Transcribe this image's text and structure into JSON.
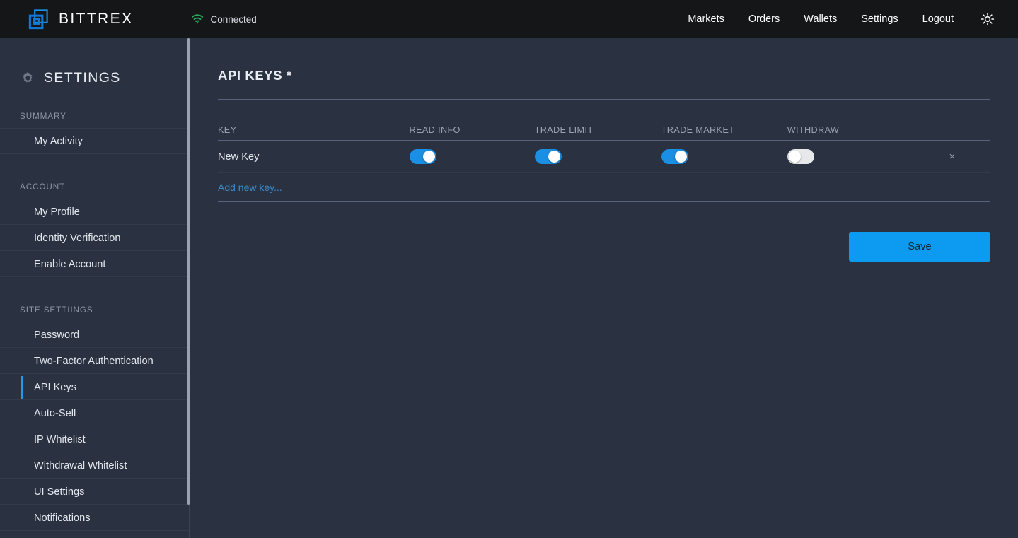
{
  "topbar": {
    "brand_name": "BITTREX",
    "logo_icon": "bittrex-overlapping-squares-logo",
    "connection": {
      "icon": "wifi-icon",
      "label": "Connected",
      "color": "#27a95c"
    },
    "nav_items": [
      {
        "label": "Markets"
      },
      {
        "label": "Orders"
      },
      {
        "label": "Wallets"
      },
      {
        "label": "Settings"
      },
      {
        "label": "Logout"
      }
    ],
    "theme_toggle_icon": "sun-brightness-icon"
  },
  "sidebar": {
    "header_icon": "gear-icon",
    "header_title": "SETTINGS",
    "sections": [
      {
        "label": "SUMMARY",
        "items": [
          {
            "label": "My Activity",
            "active": false
          }
        ]
      },
      {
        "label": "ACCOUNT",
        "items": [
          {
            "label": "My Profile",
            "active": false
          },
          {
            "label": "Identity Verification",
            "active": false
          },
          {
            "label": "Enable Account",
            "active": false
          }
        ]
      },
      {
        "label": "SITE SETTIINGS",
        "items": [
          {
            "label": "Password",
            "active": false
          },
          {
            "label": "Two-Factor Authentication",
            "active": false
          },
          {
            "label": "API Keys",
            "active": true
          },
          {
            "label": "Auto-Sell",
            "active": false
          },
          {
            "label": "IP Whitelist",
            "active": false
          },
          {
            "label": "Withdrawal Whitelist",
            "active": false
          },
          {
            "label": "UI Settings",
            "active": false
          },
          {
            "label": "Notifications",
            "active": false
          }
        ]
      }
    ]
  },
  "main": {
    "page_title": "API KEYS *",
    "table": {
      "headers": {
        "key": "KEY",
        "read_info": "READ INFO",
        "trade_limit": "TRADE LIMIT",
        "trade_market": "TRADE MARKET",
        "withdraw": "WITHDRAW",
        "delete": ""
      },
      "rows": [
        {
          "key": "New Key",
          "read_info": true,
          "trade_limit": true,
          "trade_market": true,
          "withdraw": false,
          "delete_icon": "close-x-icon",
          "delete_label": "×"
        }
      ]
    },
    "add_new_key_label": "Add new key...",
    "save_label": "Save"
  },
  "colors": {
    "accent_blue": "#0d9bf2",
    "toggle_on": "#1a8fe3",
    "toggle_off": "#e6e8ea",
    "link_blue": "#3e88c6",
    "topbar_bg": "#141618",
    "page_bg": "#2a3241",
    "connected_green": "#27a95c"
  }
}
